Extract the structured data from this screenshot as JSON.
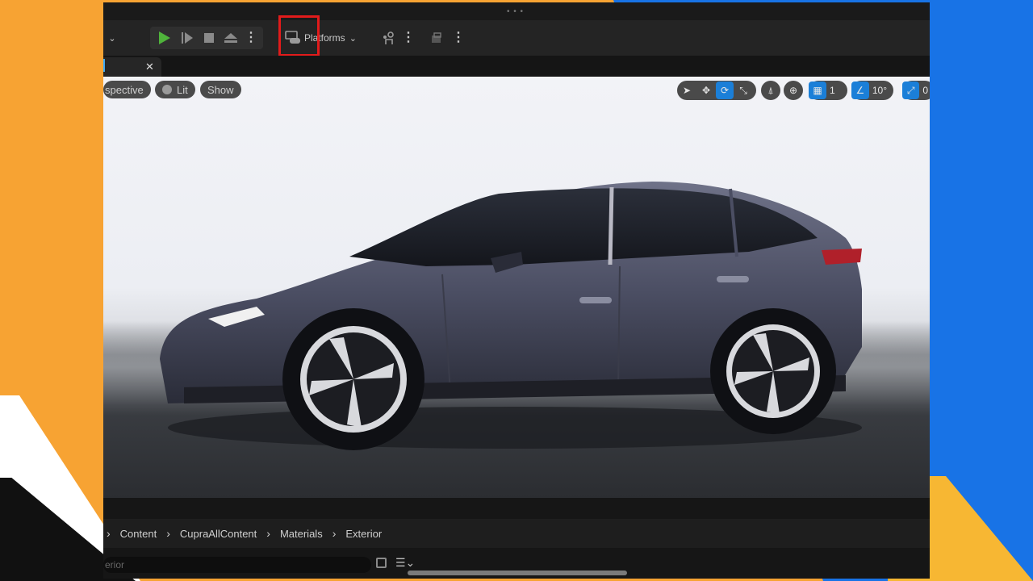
{
  "toolbar": {
    "platforms_label": "Platforms"
  },
  "viewport": {
    "perspective_label": "spective",
    "lit_label": "Lit",
    "show_label": "Show",
    "grid_snap_value": "1",
    "rotation_snap_value": "10°",
    "scale_snap_value": "0"
  },
  "breadcrumbs": [
    "Content",
    "CupraAllContent",
    "Materials",
    "Exterior"
  ],
  "search": {
    "value": "erior"
  },
  "colors": {
    "accent_blue": "#1b7fd8",
    "play_green": "#4fb33b",
    "highlight_red": "#e11b1b",
    "frame_orange": "#f7a333",
    "frame_blue": "#1873e6"
  },
  "icons": [
    "play-icon",
    "skip-icon",
    "stop-icon",
    "eject-icon",
    "platforms-icon",
    "settings-icon",
    "select-icon",
    "translate-icon",
    "rotate-icon",
    "scale-icon",
    "surface-snap-icon",
    "world-icon",
    "grid-icon",
    "angle-icon",
    "camera-speed-icon",
    "save-icon",
    "filter-icon"
  ]
}
